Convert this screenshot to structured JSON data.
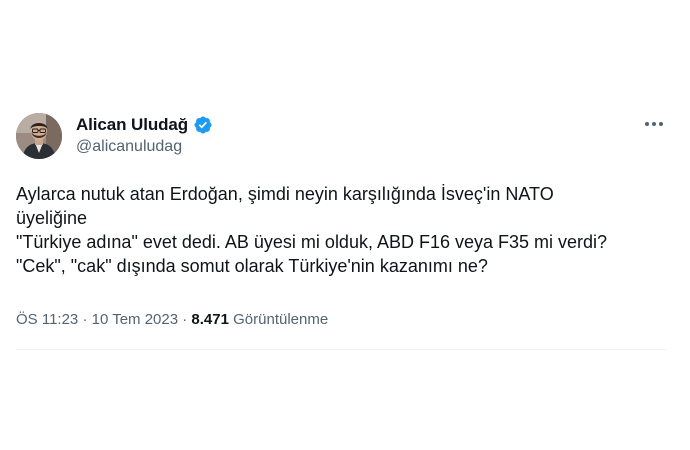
{
  "author": {
    "display_name": "Alican Uludağ",
    "handle": "@alicanuludag",
    "verified": true,
    "avatar_icon": "profile-photo"
  },
  "tweet": {
    "lines": [
      "Aylarca nutuk atan Erdoğan, şimdi neyin karşılığında İsveç'in NATO",
      "üyeliğine",
      "\"Türkiye adına\" evet dedi. AB üyesi mi olduk, ABD F16 veya F35 mi verdi?",
      "\"Cek\", \"cak\" dışında somut olarak Türkiye'nin kazanımı ne?"
    ]
  },
  "meta": {
    "time": "ÖS 11:23",
    "date": "10 Tem 2023",
    "separator": "·",
    "views_count": "8.471",
    "views_label": "Görüntülenme"
  },
  "icons": {
    "verified": "verified-badge-icon",
    "more": "more-options-icon"
  },
  "colors": {
    "verified_blue": "#1d9bf0",
    "text_primary": "#0f1419",
    "text_secondary": "#536471"
  }
}
